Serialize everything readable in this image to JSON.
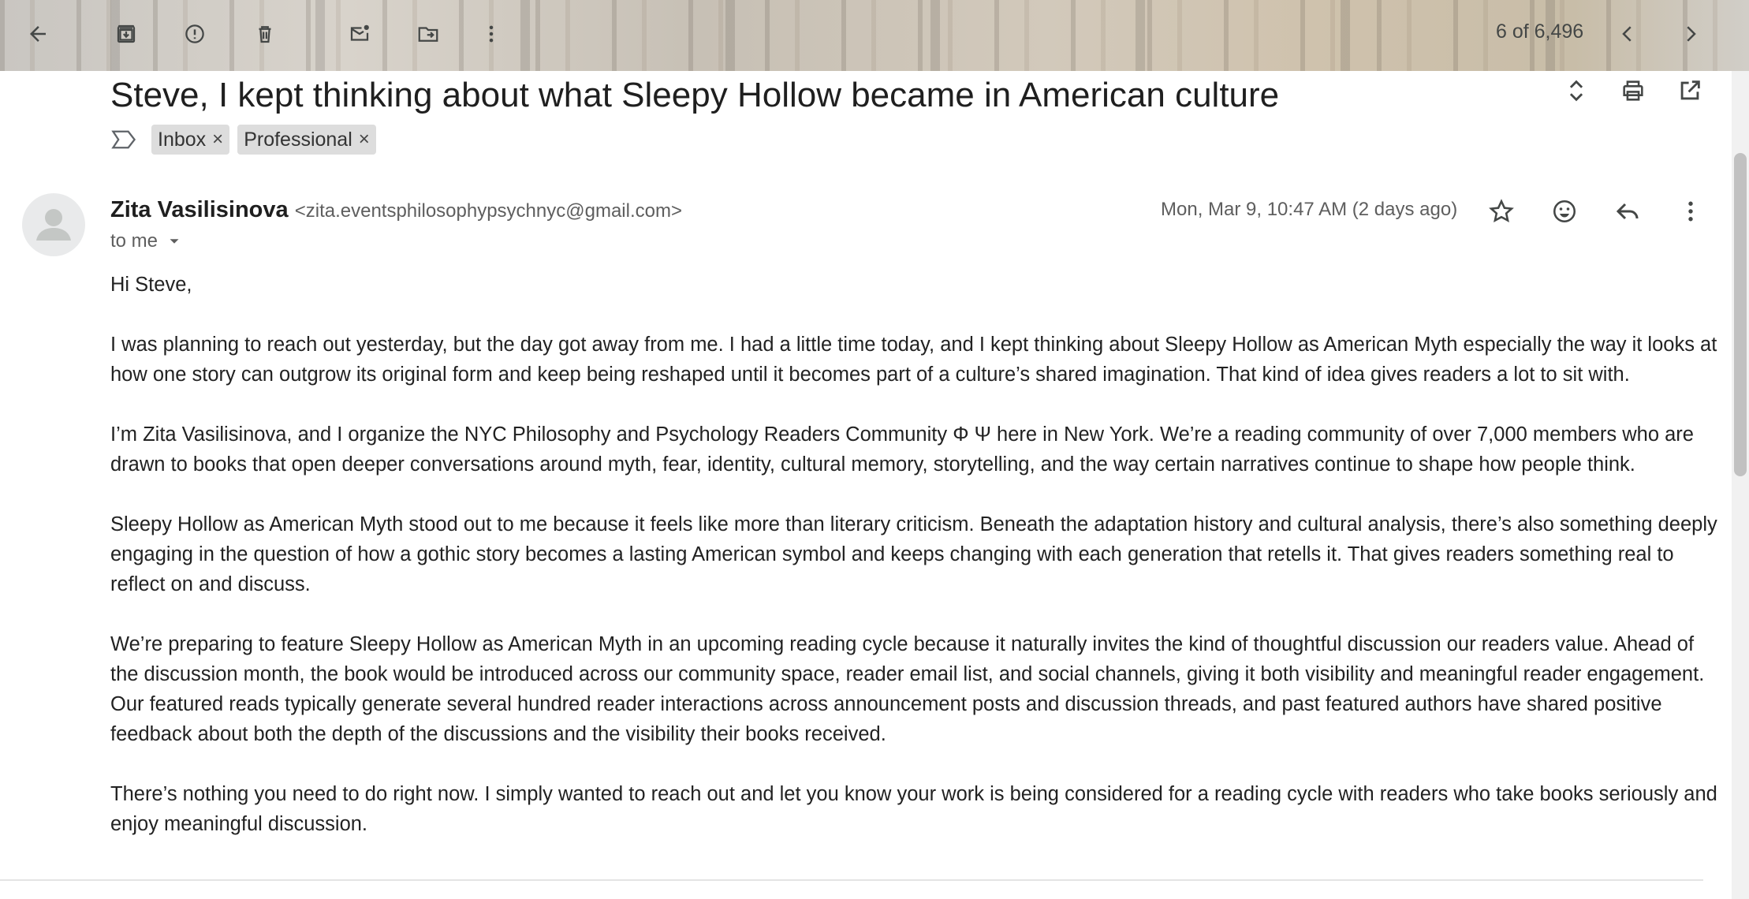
{
  "toolbar": {
    "counter": "6 of 6,496"
  },
  "subject": "Steve, I kept thinking about what Sleepy Hollow became in American culture",
  "labels": [
    "Inbox",
    "Professional"
  ],
  "sender": {
    "name": "Zita Vasilisinova",
    "email": "<zita.eventsphilosophypsychnyc@gmail.com>",
    "to": "to me",
    "date": "Mon, Mar 9, 10:47 AM (2 days ago)"
  },
  "body": {
    "greeting": "Hi Steve,",
    "p1": "I was planning to reach out yesterday, but the day got away from me. I had a little time today, and I kept thinking about Sleepy Hollow as American Myth especially the way it looks at how one story can outgrow its original form and keep being reshaped until it becomes part of a culture’s shared imagination. That kind of idea gives readers a lot to sit with.",
    "p2": "I’m Zita Vasilisinova, and I organize the NYC Philosophy and Psychology Readers Community Φ Ψ here in New York. We’re a reading community of over 7,000 members who are drawn to books that open deeper conversations around myth, fear, identity, cultural memory, storytelling, and the way certain narratives continue to shape how people think.",
    "p3": "Sleepy Hollow as American Myth stood out to me because it feels like more than literary criticism. Beneath the adaptation history and cultural analysis, there’s also something deeply engaging in the question of how a gothic story becomes a lasting American symbol and keeps changing with each generation that retells it. That gives readers something real to reflect on and discuss.",
    "p4": "We’re preparing to feature Sleepy Hollow as American Myth in an upcoming reading cycle because it naturally invites the kind of thoughtful discussion our readers value. Ahead of the discussion month, the book would be introduced across our community space, reader email list, and social channels, giving it both visibility and meaningful reader engagement. Our featured reads typically generate several hundred reader interactions across announcement posts and discussion threads, and past featured authors have shared positive feedback about both the depth of the discussions and the visibility their books received.",
    "p5": "There’s nothing you need to do right now. I simply wanted to reach out and let you know your work is being considered for a reading cycle with readers who take books seriously and enjoy meaningful discussion."
  }
}
